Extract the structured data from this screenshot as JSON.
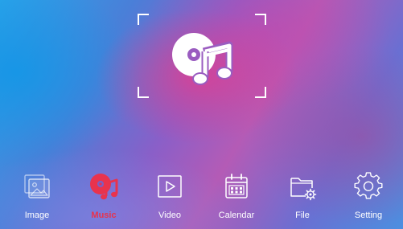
{
  "colors": {
    "accent": "#e8334d",
    "icon": "#ffffff",
    "label": "#ffffff"
  },
  "hero": {
    "icon": "music-icon"
  },
  "dock": {
    "selected": "Music",
    "items": [
      {
        "label": "Image",
        "icon": "image-icon"
      },
      {
        "label": "Music",
        "icon": "music-icon"
      },
      {
        "label": "Video",
        "icon": "video-icon"
      },
      {
        "label": "Calendar",
        "icon": "calendar-icon"
      },
      {
        "label": "File",
        "icon": "file-icon"
      },
      {
        "label": "Setting",
        "icon": "setting-icon"
      }
    ]
  }
}
